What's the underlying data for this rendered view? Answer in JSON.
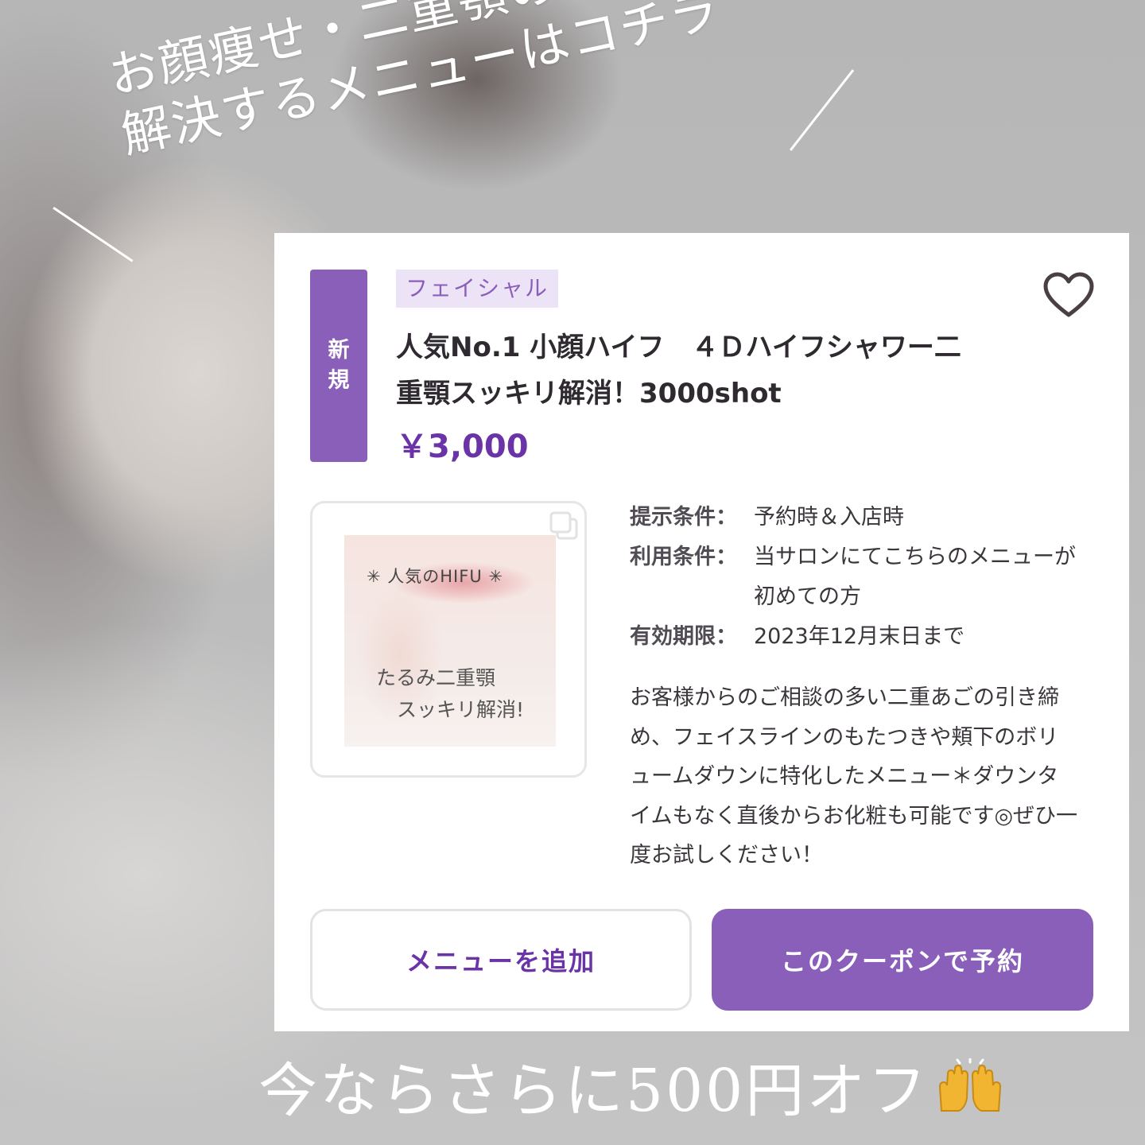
{
  "headline": {
    "line1": "お顔痩せ・二重顎のお悩みを",
    "line2": "解決するメニューはコチラ"
  },
  "coupon": {
    "badge_line1": "新",
    "badge_line2": "規",
    "category": "フェイシャル",
    "favorite_icon": "heart-icon",
    "title_line1": "人気No.1 小顔ハイフ　４Ｄハイフシャワー二",
    "title_line2": "重顎スッキリ解消！3000shot",
    "price": "￥3,000",
    "image": {
      "copy_icon": "copy-icon",
      "caption_top": "✳︎ 人気のHIFU ✳︎",
      "caption_line1": "たるみ二重顎",
      "caption_line2": "スッキリ解消!"
    },
    "terms": [
      {
        "label": "提示条件：",
        "value": "予約時＆入店時"
      },
      {
        "label": "利用条件：",
        "value": "当サロンにてこちらのメニューが初めての方"
      },
      {
        "label": "有効期限：",
        "value": "2023年12月末日まで"
      }
    ],
    "description": "お客様からのご相談の多い二重あごの引き締め、フェイスラインのもたつきや頬下のボリュームダウンに特化したメニュー＊ダウンタイムもなく直後からお化粧も可能です◎ぜひ一度お試しください！",
    "add_menu_label": "メニューを追加",
    "reserve_label": "このクーポンで予約"
  },
  "footer": {
    "text": "今ならさらに500円オフ",
    "icon": "raising-hands-icon"
  },
  "colors": {
    "accent": "#8a5fba",
    "price": "#6b33a8",
    "category_bg": "#ece3f6"
  }
}
